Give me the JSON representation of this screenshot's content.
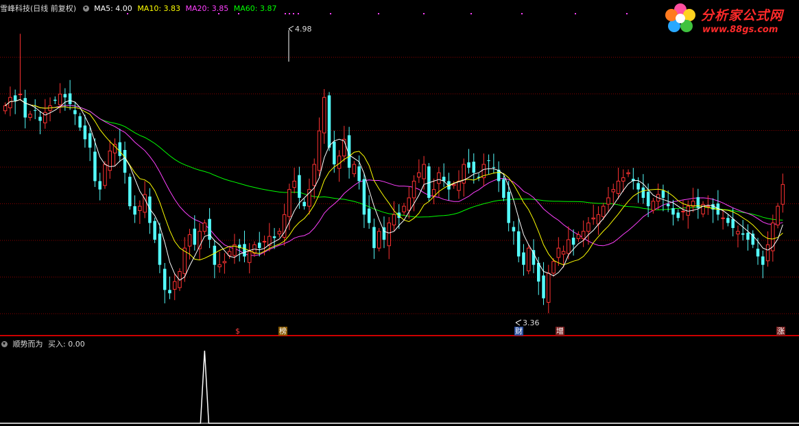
{
  "header": {
    "title": "雪峰科技(日线 前复权)",
    "ma5": "MA5: 4.00",
    "ma10": "MA10: 3.83",
    "ma20": "MA20: 3.85",
    "ma60": "MA60: 3.87"
  },
  "indicator": {
    "title": "顺势而为",
    "buy_label": "买入: 0.00"
  },
  "logo": {
    "name": "分析家公式网",
    "url": "www.88gs.com"
  },
  "annotations": {
    "high_label": "4.98",
    "low_label": "3.36",
    "tag_1": "$",
    "tag_2": "榜",
    "tag_3": "财",
    "tag_4": "增",
    "tag_5": "涨"
  },
  "colors": {
    "up": "#ff3232",
    "down": "#54ffff",
    "ma5": "#ffffff",
    "ma10": "#ffff00",
    "ma20": "#ff40ff",
    "ma60": "#00ff00",
    "grid": "#8b0000"
  },
  "chart_data": {
    "type": "candlestick",
    "y_range": [
      3.3,
      5.1
    ],
    "price_high": 4.98,
    "price_low": 3.36,
    "moving_averages": [
      "MA5",
      "MA10",
      "MA20",
      "MA60"
    ],
    "closes": [
      4.55,
      4.6,
      4.58,
      4.62,
      4.48,
      4.5,
      4.52,
      4.46,
      4.51,
      4.55,
      4.58,
      4.62,
      4.6,
      4.56,
      4.5,
      4.42,
      4.35,
      4.3,
      4.1,
      4.05,
      4.2,
      4.28,
      4.32,
      4.25,
      4.15,
      3.95,
      3.9,
      3.95,
      4.02,
      3.85,
      3.75,
      3.6,
      3.45,
      3.43,
      3.5,
      3.56,
      3.7,
      3.78,
      3.72,
      3.8,
      3.85,
      3.75,
      3.6,
      3.6,
      3.62,
      3.68,
      3.72,
      3.7,
      3.65,
      3.68,
      3.72,
      3.7,
      3.74,
      3.77,
      3.76,
      3.8,
      3.9,
      4.05,
      4.1,
      4.0,
      3.95,
      4.05,
      4.2,
      4.4,
      4.6,
      4.3,
      4.2,
      4.25,
      4.35,
      4.18,
      4.2,
      4.1,
      3.9,
      3.85,
      3.7,
      3.8,
      3.75,
      3.85,
      3.9,
      3.88,
      3.95,
      4.0,
      4.1,
      4.15,
      4.2,
      4.0,
      4.05,
      4.15,
      4.1,
      4.05,
      4.08,
      4.1,
      4.2,
      4.18,
      4.15,
      4.12,
      4.2,
      4.22,
      4.18,
      4.1,
      4.0,
      3.85,
      3.8,
      3.65,
      3.6,
      3.7,
      3.6,
      3.5,
      3.4,
      3.55,
      3.62,
      3.7,
      3.68,
      3.75,
      3.72,
      3.78,
      3.8,
      3.85,
      3.88,
      3.9,
      3.95,
      4.0,
      4.05,
      4.1,
      4.12,
      4.15,
      4.1,
      4.05,
      4.0,
      3.95,
      3.98,
      4.02,
      4.0,
      3.95,
      3.9,
      3.88,
      3.92,
      3.95,
      3.98,
      3.94,
      3.96,
      3.95,
      3.93,
      3.9,
      3.88,
      3.85,
      3.82,
      3.8,
      3.78,
      3.75,
      3.72,
      3.65,
      3.6,
      3.72,
      3.85,
      3.95,
      4.08
    ],
    "buy_signal": {
      "index": 40,
      "value": 1
    }
  }
}
